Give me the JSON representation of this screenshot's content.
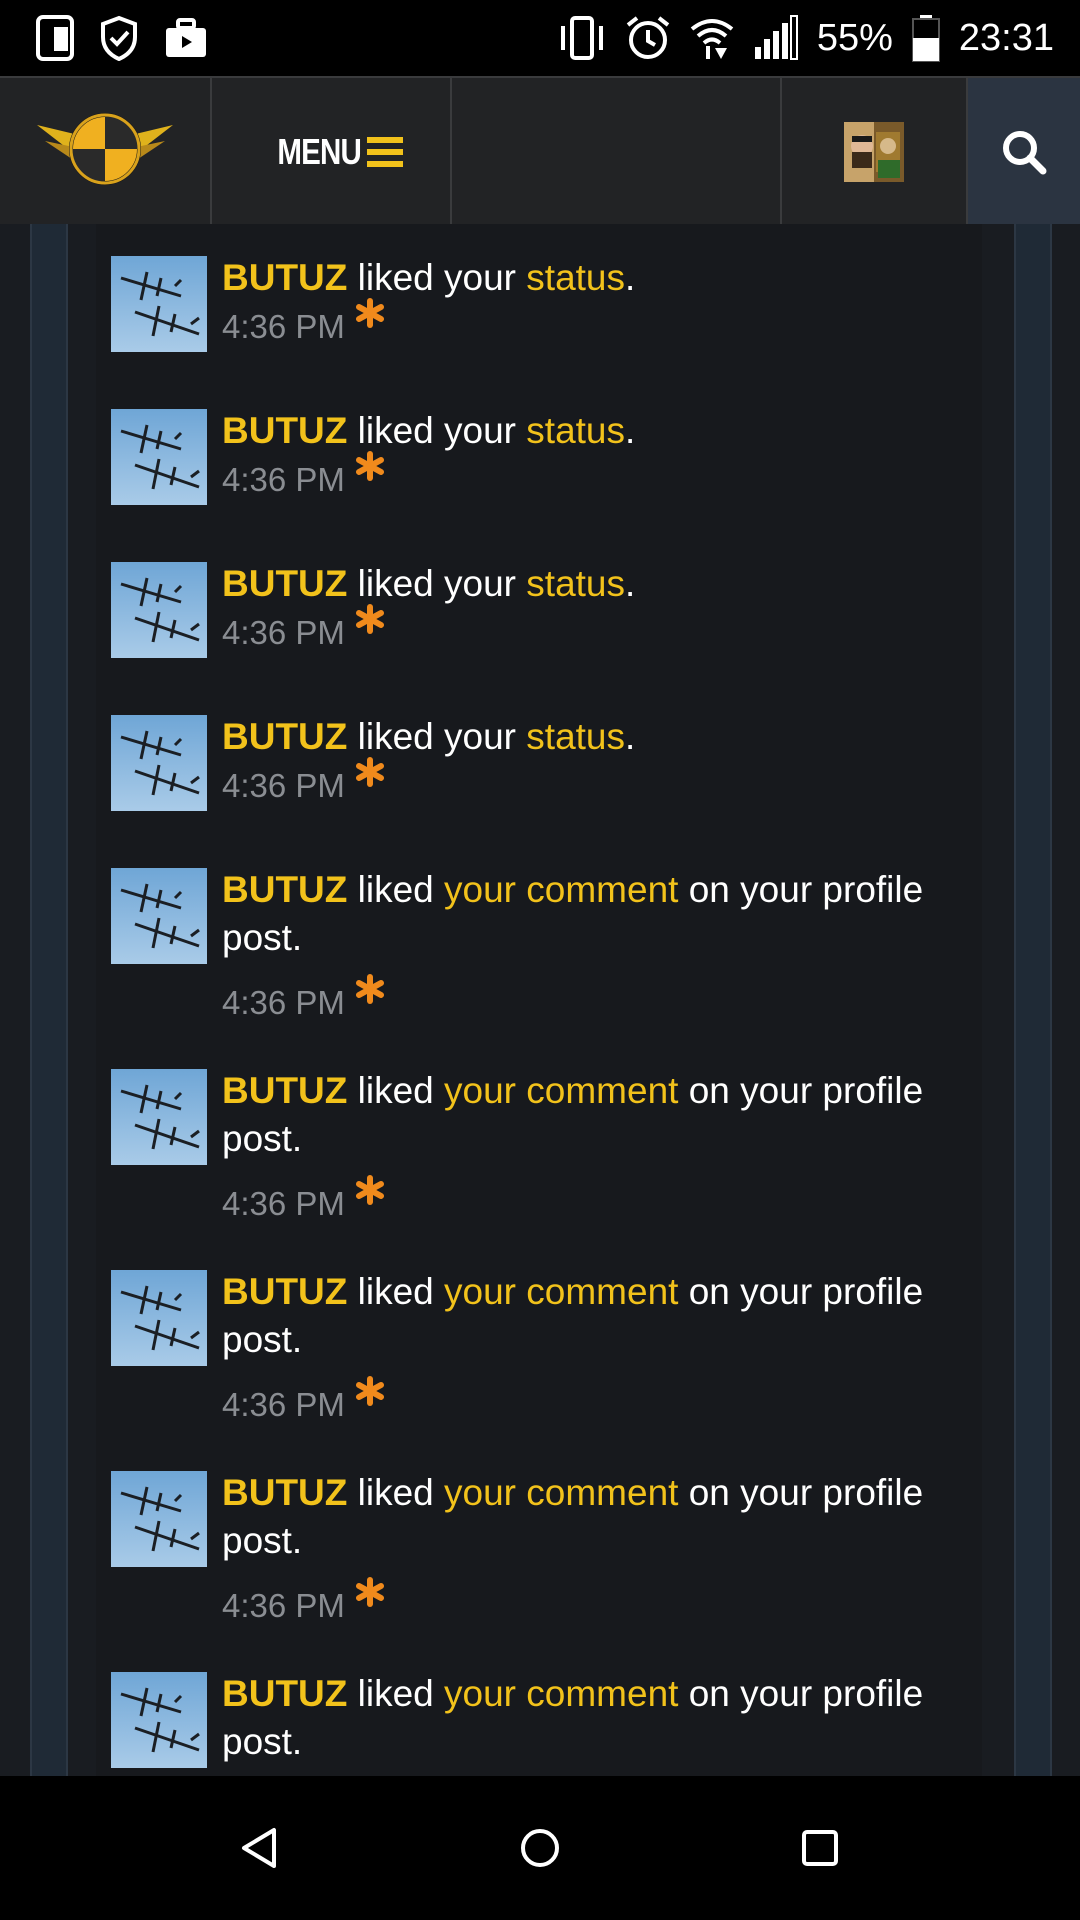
{
  "status_bar": {
    "battery": "55%",
    "time": "23:31",
    "icons_left": [
      "device-icon",
      "shield-check-icon",
      "briefcase-icon"
    ],
    "icons_right": [
      "vibrate-icon",
      "alarm-icon",
      "wifi-icon",
      "signal-icon",
      "battery-icon"
    ]
  },
  "header": {
    "menu_label": "MENU",
    "icons": [
      "site-logo",
      "menu-icon",
      "avatar",
      "search-icon"
    ]
  },
  "colors": {
    "accent": "#f2c21b",
    "star": "#f08a1c",
    "time": "#8a8d92",
    "panel": "#17191d"
  },
  "notifications": [
    {
      "user": "BUTUZ",
      "verb": " liked ",
      "prefix": "your ",
      "link": "status",
      "suffix": ".",
      "time": "4:36 PM"
    },
    {
      "user": "BUTUZ",
      "verb": " liked ",
      "prefix": "your ",
      "link": "status",
      "suffix": ".",
      "time": "4:36 PM"
    },
    {
      "user": "BUTUZ",
      "verb": " liked ",
      "prefix": "your ",
      "link": "status",
      "suffix": ".",
      "time": "4:36 PM"
    },
    {
      "user": "BUTUZ",
      "verb": " liked ",
      "prefix": "your ",
      "link": "status",
      "suffix": ".",
      "time": "4:36 PM"
    },
    {
      "user": "BUTUZ",
      "verb": " liked ",
      "prefix": "",
      "link": "your comment",
      "suffix": " on your profile post.",
      "time": "4:36 PM"
    },
    {
      "user": "BUTUZ",
      "verb": " liked ",
      "prefix": "",
      "link": "your comment",
      "suffix": " on your profile post.",
      "time": "4:36 PM"
    },
    {
      "user": "BUTUZ",
      "verb": " liked ",
      "prefix": "",
      "link": "your comment",
      "suffix": " on your profile post.",
      "time": "4:36 PM"
    },
    {
      "user": "BUTUZ",
      "verb": " liked ",
      "prefix": "",
      "link": "your comment",
      "suffix": " on your profile post.",
      "time": "4:36 PM"
    },
    {
      "user": "BUTUZ",
      "verb": " liked ",
      "prefix": "",
      "link": "your comment",
      "suffix": " on your profile post.",
      "time": ""
    }
  ],
  "nav_bar": {
    "buttons": [
      "back-icon",
      "home-icon",
      "recents-icon"
    ]
  }
}
